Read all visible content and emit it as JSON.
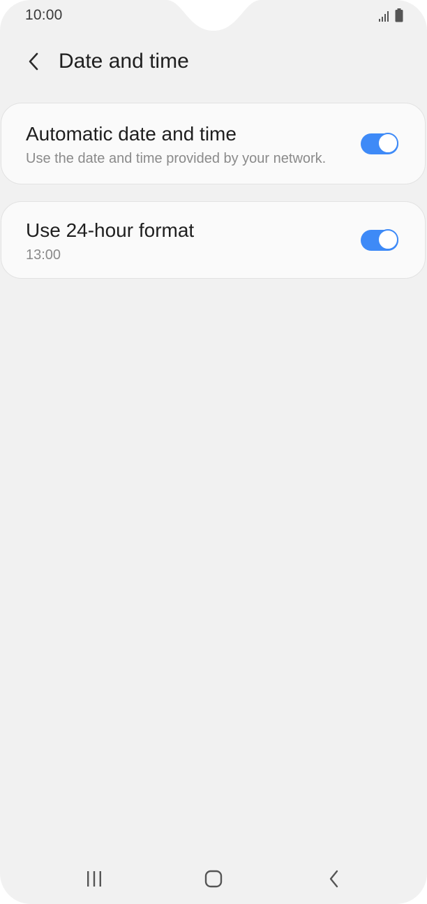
{
  "status_bar": {
    "time": "10:00",
    "signal_icon": "signal-bars-icon",
    "battery_icon": "battery-icon"
  },
  "header": {
    "back_icon": "chevron-left-icon",
    "title": "Date and time"
  },
  "settings": [
    {
      "title": "Automatic date and time",
      "subtitle": "Use the date and time provided by your network.",
      "enabled": true
    },
    {
      "title": "Use 24-hour format",
      "subtitle": "13:00",
      "enabled": true
    }
  ],
  "nav_bar": {
    "recents_icon": "recents-icon",
    "home_icon": "home-icon",
    "back_icon": "back-icon"
  },
  "colors": {
    "background": "#f1f1f1",
    "card": "#fafafa",
    "accent": "#3e8af7"
  }
}
